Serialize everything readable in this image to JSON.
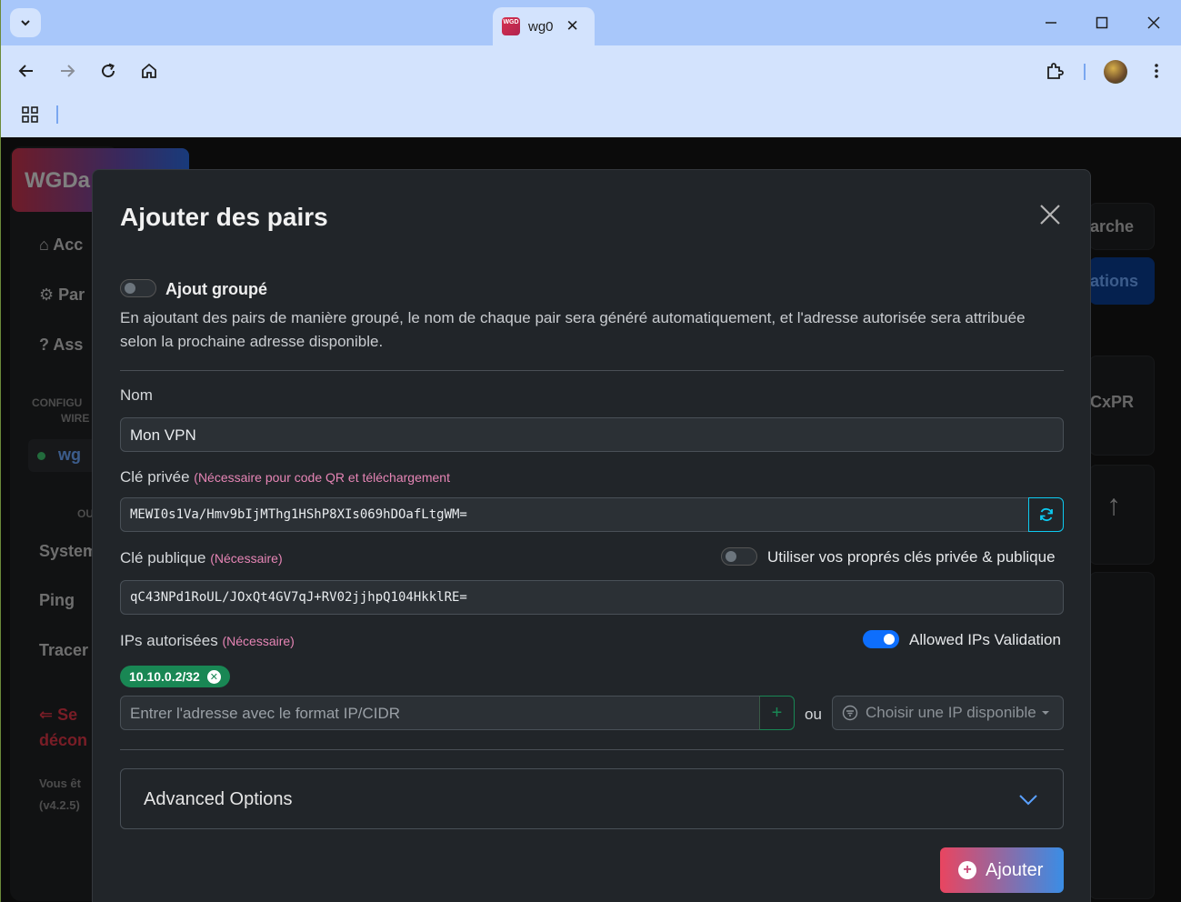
{
  "browser": {
    "tab_title": "wg0",
    "favicon_text": "WGD",
    "tab_close": "✕"
  },
  "background": {
    "brand": "WGDa",
    "nav": [
      "Acc",
      "Par",
      "Ass"
    ],
    "section_label_1": "CONFIGU",
    "section_label_2": "WIRE",
    "config_item": "wg",
    "other_label": "OU",
    "tools": [
      "System",
      "Ping",
      "Tracer"
    ],
    "logout_1": "Se",
    "logout_2": "décon",
    "version_1": "Vous êt",
    "version_2": "(v4.2.5)",
    "right_search": "arche",
    "right_config": "ations",
    "right_key": "CxPR"
  },
  "modal": {
    "title": "Ajouter des pairs",
    "bulk_label": "Ajout groupé",
    "bulk_enabled": false,
    "bulk_description": "En ajoutant des pairs de manière groupé, le nom de chaque pair sera généré automatiquement, et l'adresse autorisée sera attribuée selon la prochaine adresse disponible.",
    "name_label": "Nom",
    "name_value": "Mon VPN",
    "private_key_label": "Clé privée",
    "private_key_note": "(Nécessaire pour code QR et téléchargement",
    "private_key_value": "MEWI0s1Va/Hmv9bIjMThg1HShP8XIs069hDOafLtgWM=",
    "public_key_label": "Clé publique",
    "public_key_note": "(Nécessaire)",
    "own_keys_label": "Utiliser vos proprés clés privée & publique",
    "own_keys_enabled": false,
    "public_key_value": "qC43NPd1RoUL/JOxQt4GV7qJ+RV02jjhpQ104HkklRE=",
    "allowed_ips_label": "IPs autorisées",
    "allowed_ips_note": "(Nécessaire)",
    "allowed_ips_validation_label": "Allowed IPs Validation",
    "allowed_ips_validation_enabled": true,
    "allowed_ip_chip": "10.10.0.2/32",
    "ip_input_placeholder": "Entrer l'adresse avec le format IP/CIDR",
    "add_ip_symbol": "+",
    "or_label": "ou",
    "available_ip_placeholder": "Choisir une IP disponible",
    "advanced_label": "Advanced Options",
    "submit_label": "Ajouter"
  }
}
